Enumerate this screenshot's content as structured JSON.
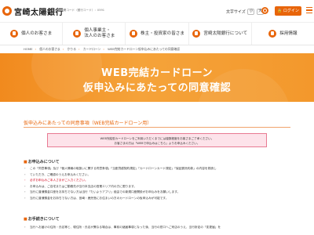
{
  "header": {
    "logo_text": "宮崎太陽銀行",
    "bank_code": "金融機関コード（銀行コード）：0591",
    "font_size_label": "文字サイズ",
    "font_size_options": [
      "小",
      "大"
    ],
    "login_label": "🔒 ログイン",
    "accent_color": "#e8650a"
  },
  "nav": {
    "items": [
      {
        "label": "個人のお客さま",
        "icon": "person-icon"
      },
      {
        "label": "個人事業主・\n法人のお客さま",
        "icon": "building-icon"
      },
      {
        "label": "株主・投資家の皆さま",
        "icon": "chart-icon"
      },
      {
        "label": "宮崎太陽銀行について",
        "icon": "bank-icon"
      },
      {
        "label": "採用情報",
        "icon": "people-icon"
      }
    ]
  },
  "breadcrumb": [
    "HOME",
    "個人のお客さま",
    "かりる",
    "カードローン",
    "WEB完結カードローン仮申込みにあたっての同意確認"
  ],
  "hero": {
    "line1": "WEB完結カードローン",
    "line2": "仮申込みにあたっての同意確認"
  },
  "section_title": "仮申込みにあたっての同意事項（WEB完結カードローン用）",
  "notice": {
    "line1": "WEB完結型カードローンをご利用いただくまでには複数程度をお客さまご了承ください。",
    "line2": "お客さまの方は「WEBで申込みはこちら」よりお申込みください。"
  },
  "section1": {
    "heading": "お申込みについて",
    "bullets": [
      {
        "text": "この「同意事項」及び「個人情報の取扱いに関する同意条項」「当座貸越契約規定」「カードローンカード規定」「保証委託約款」の内容を熟読し",
        "red": false
      },
      {
        "text": "ていただき、ご確認のうえお申込みください。",
        "red": false
      },
      {
        "text": "必ずお申込みご本人さまがご入力ください。",
        "red": true
      },
      {
        "text": "お申込みは、ご自宅またはご勤務先が当行本支店の営業エリア内の方に限ります。",
        "red": false
      },
      {
        "text": "当行に普通預金口座をお持ちでない方は当行「たいようアプリ」経由での新規口座開設がお申込みをお願いします。",
        "red": false
      },
      {
        "text": "当行に普通預金をお持ちでない方は、宮崎・鹿児島にお住まいの方のカードローンの仮申込みが可能です。",
        "red": false
      }
    ]
  },
  "section2": {
    "heading": "お手続きについて",
    "bullets": [
      {
        "text": "当行へお届けの住所・氏名等と、現住所・氏名が異なる場合は、事前の諸届事項となった後、当行の窓口へご来店のうえ、当行所定の「変更届」を",
        "red": false
      }
    ]
  }
}
